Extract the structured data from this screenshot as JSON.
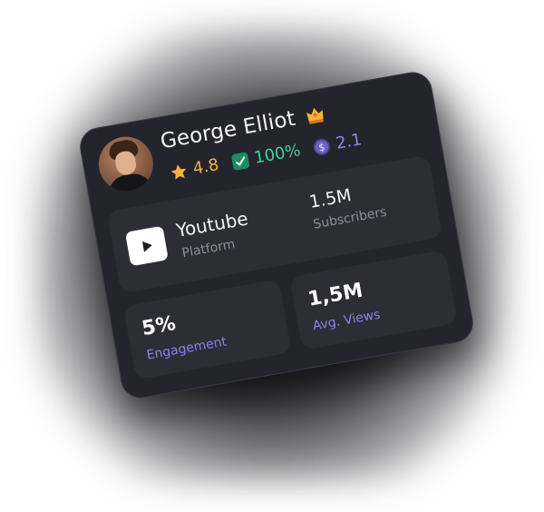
{
  "profile": {
    "name": "George Elliot",
    "rating": "4.8",
    "verified": "100%",
    "coins": "2.1"
  },
  "platform": {
    "name": "Youtube",
    "label": "Platform"
  },
  "subscribers": {
    "value": "1.5M",
    "label": "Subscribers"
  },
  "engagement": {
    "value": "5%",
    "label": "Engagement"
  },
  "views": {
    "value": "1,5M",
    "label": "Avg. Views"
  },
  "colors": {
    "card": "#24242c",
    "tile": "#2d2d36",
    "rating": "#f3b33d",
    "verified": "#3fd296",
    "coin": "#8f86e8",
    "label_accent": "#8b84e8",
    "youtube_red": "#ff0000"
  },
  "icons": {
    "crown": "crown-icon",
    "star": "star-icon",
    "check": "check-icon",
    "coin": "dollar-coin-icon",
    "youtube": "youtube-play-icon"
  }
}
